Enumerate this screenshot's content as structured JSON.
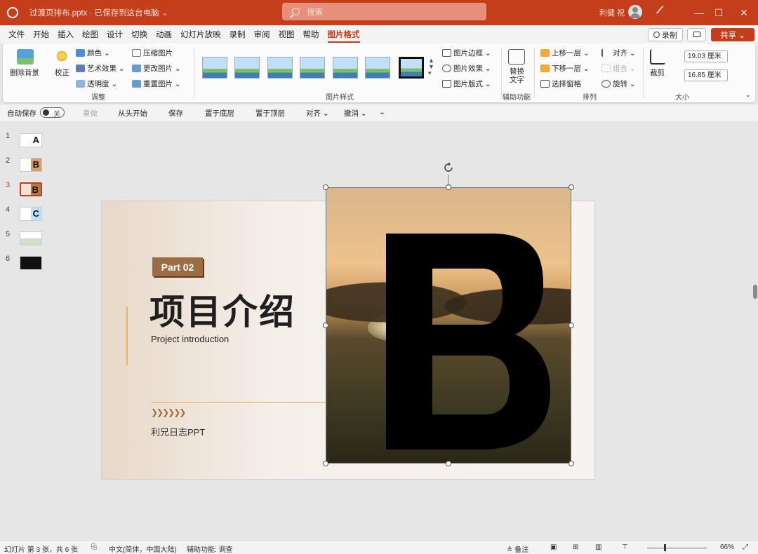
{
  "titlebar": {
    "doc_title": "过渡页排布.pptx · 已保存到这台电脑 ⌄",
    "search_placeholder": "搜索",
    "user_name": "利健 祝",
    "minimize": "—",
    "maximize": "☐",
    "close": "✕"
  },
  "menu": {
    "tabs": [
      "文件",
      "开始",
      "插入",
      "绘图",
      "设计",
      "切换",
      "动画",
      "幻灯片放映",
      "录制",
      "审阅",
      "视图",
      "帮助",
      "图片格式"
    ],
    "record": "录制",
    "share": "共享 ⌄"
  },
  "ribbon": {
    "remove_bg": "删除背景",
    "corrections": "校正",
    "color": "颜色 ⌄",
    "artistic": "艺术效果 ⌄",
    "transparency": "透明度 ⌄",
    "compress": "压缩图片",
    "change_pic": "更改图片 ⌄",
    "reset_pic": "重置图片 ⌄",
    "group_adjust": "调整",
    "border": "图片边框 ⌄",
    "effects": "图片效果 ⌄",
    "layout": "图片版式 ⌄",
    "group_styles": "图片样式",
    "alt_text": "替换\n文字",
    "alt_text_l1": "替换",
    "alt_text_l2": "文字",
    "group_access": "辅助功能",
    "bring_forward": "上移一层 ⌄",
    "send_backward": "下移一层 ⌄",
    "selection_pane": "选择窗格",
    "align": "对齐 ⌄",
    "group_obj": "组合 ⌄",
    "rotate": "旋转 ⌄",
    "group_arrange": "排列",
    "crop": "裁剪",
    "height": "19.03 厘米",
    "width": "16.85 厘米",
    "group_size": "大小"
  },
  "qat": {
    "autosave": "自动保存",
    "autosave_state": "关",
    "redo": "重做",
    "from_start": "从头开始",
    "save": "保存",
    "to_back": "置于底层",
    "to_front": "置于顶层",
    "align": "对齐 ⌄",
    "undo": "撤消 ⌄",
    "more": "⌄"
  },
  "thumbnails": [
    {
      "num": "1",
      "letter": "A"
    },
    {
      "num": "2",
      "letter": "B"
    },
    {
      "num": "3",
      "letter": "B"
    },
    {
      "num": "4",
      "letter": "C"
    },
    {
      "num": "5",
      "letter": ""
    },
    {
      "num": "6",
      "letter": ""
    }
  ],
  "slide": {
    "tag": "Part 02",
    "title": "项目介绍",
    "subtitle": "Project introduction",
    "arrows": "❯❯❯❯❯❯",
    "footer": "利兄日志PPT",
    "big_letter": "B"
  },
  "statusbar": {
    "slide_info": "幻灯片 第 3 张，共 6 张",
    "language": "中文(简体，中国大陆)",
    "accessibility": "辅助功能: 调查",
    "notes": "≜ 备注",
    "zoom": "66%"
  },
  "colors": {
    "accent": "#c43e1c",
    "tag_brown": "#9c6c45",
    "gold_line": "#e2a64f"
  }
}
